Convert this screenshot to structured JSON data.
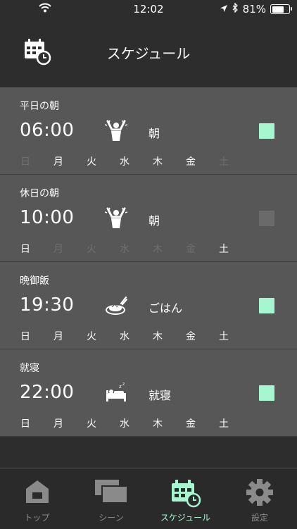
{
  "status_bar": {
    "time": "12:02",
    "battery": "81%",
    "battery_level": 0.81
  },
  "header": {
    "title": "スケジュール"
  },
  "colors": {
    "accent": "#a6f7cf",
    "toggle_off": "#6a6a6a",
    "card_bg": "#575757",
    "background": "#2d2d2d"
  },
  "weekdays": [
    "日",
    "月",
    "火",
    "水",
    "木",
    "金",
    "土"
  ],
  "schedules": [
    {
      "name": "平日の朝",
      "time": "06:00",
      "icon": "wake-up-icon",
      "scene": "朝",
      "enabled": true,
      "days_active": [
        false,
        true,
        true,
        true,
        true,
        true,
        false
      ]
    },
    {
      "name": "休日の朝",
      "time": "10:00",
      "icon": "wake-up-icon",
      "scene": "朝",
      "enabled": false,
      "days_active": [
        true,
        false,
        false,
        false,
        false,
        false,
        true
      ]
    },
    {
      "name": "晩御飯",
      "time": "19:30",
      "icon": "meal-icon",
      "scene": "ごはん",
      "enabled": true,
      "days_active": [
        true,
        true,
        true,
        true,
        true,
        true,
        true
      ]
    },
    {
      "name": "就寝",
      "time": "22:00",
      "icon": "sleep-icon",
      "scene": "就寝",
      "enabled": true,
      "days_active": [
        true,
        true,
        true,
        true,
        true,
        true,
        true
      ]
    }
  ],
  "tabs": [
    {
      "label": "トップ",
      "icon": "home-icon",
      "active": false
    },
    {
      "label": "シーン",
      "icon": "scenes-icon",
      "active": false
    },
    {
      "label": "スケジュール",
      "icon": "schedule-icon",
      "active": true
    },
    {
      "label": "設定",
      "icon": "settings-gear-icon",
      "active": false
    }
  ]
}
